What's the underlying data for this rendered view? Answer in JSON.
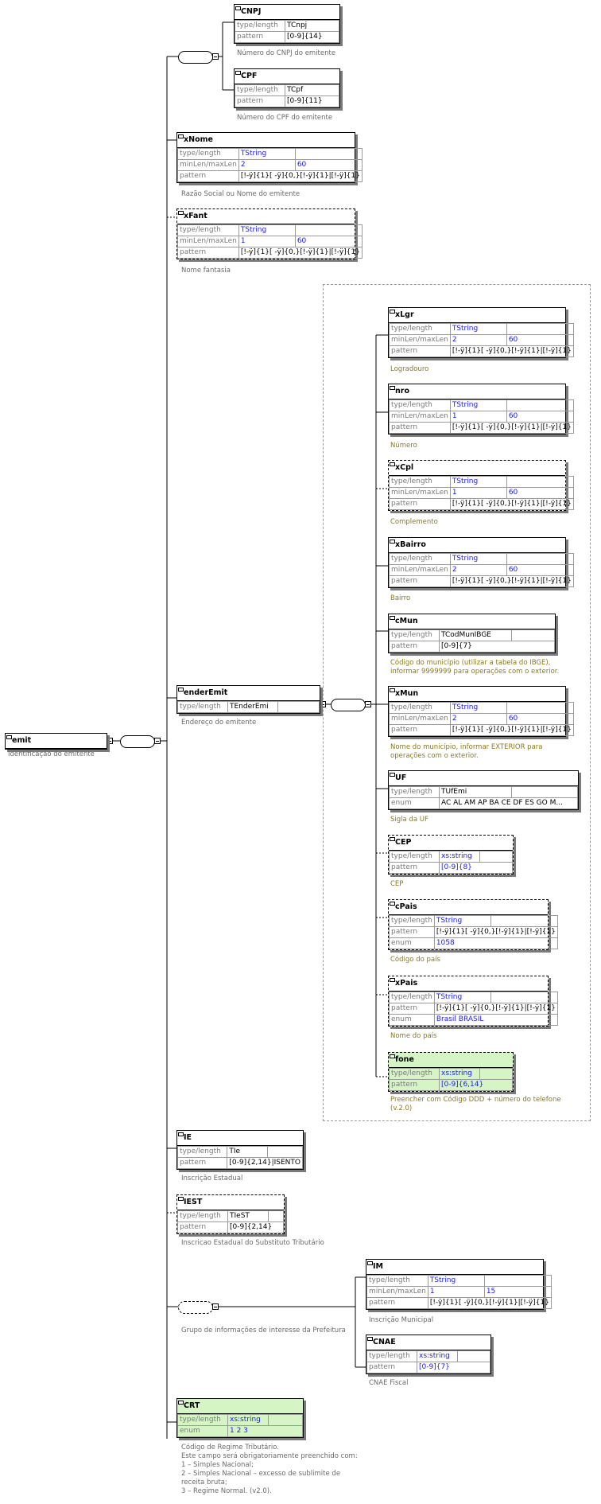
{
  "root": {
    "name": "emit",
    "desc": "Identificação do emitente"
  },
  "choice": [
    {
      "name": "CNPJ",
      "type": "TCnpj",
      "pattern": "[0-9]{14}",
      "desc": "Número do CNPJ do emitente"
    },
    {
      "name": "CPF",
      "type": "TCpf",
      "pattern": "[0-9]{11}",
      "desc": "Número do CPF do emitente"
    }
  ],
  "xNome": {
    "name": "xNome",
    "type": "TString",
    "min": "2",
    "max": "60",
    "pattern": "[!-ÿ]{1}[ -ÿ]{0,}[!-ÿ]{1}|[!-ÿ]{1}",
    "desc": "Razão Social ou Nome do emitente"
  },
  "xFant": {
    "name": "xFant",
    "type": "TString",
    "min": "1",
    "max": "60",
    "pattern": "[!-ÿ]{1}[ -ÿ]{0,}[!-ÿ]{1}|[!-ÿ]{1}",
    "desc": "Nome fantasia"
  },
  "enderEmit": {
    "name": "enderEmit",
    "type": "TEnderEmi",
    "desc": "Endereço do emitente"
  },
  "address": {
    "xLgr": {
      "name": "xLgr",
      "type": "TString",
      "min": "2",
      "max": "60",
      "pattern": "[!-ÿ]{1}[ -ÿ]{0,}[!-ÿ]{1}|[!-ÿ]{1}",
      "desc": "Logradouro"
    },
    "nro": {
      "name": "nro",
      "type": "TString",
      "min": "1",
      "max": "60",
      "pattern": "[!-ÿ]{1}[ -ÿ]{0,}[!-ÿ]{1}|[!-ÿ]{1}",
      "desc": "Número"
    },
    "xCpl": {
      "name": "xCpl",
      "type": "TString",
      "min": "1",
      "max": "60",
      "pattern": "[!-ÿ]{1}[ -ÿ]{0,}[!-ÿ]{1}|[!-ÿ]{1}",
      "desc": "Complemento"
    },
    "xBairro": {
      "name": "xBairro",
      "type": "TString",
      "min": "2",
      "max": "60",
      "pattern": "[!-ÿ]{1}[ -ÿ]{0,}[!-ÿ]{1}|[!-ÿ]{1}",
      "desc": "Bairro"
    },
    "cMun": {
      "name": "cMun",
      "type": "TCodMunIBGE",
      "pattern": "[0-9]{7}",
      "desc1": "Código do município (utilizar a tabela do IBGE),",
      "desc2": "informar 9999999 para operações com o exterior."
    },
    "xMun": {
      "name": "xMun",
      "type": "TString",
      "min": "2",
      "max": "60",
      "pattern": "[!-ÿ]{1}[ -ÿ]{0,}[!-ÿ]{1}|[!-ÿ]{1}",
      "desc1": "Nome do município, informar EXTERIOR para",
      "desc2": "operações com o exterior."
    },
    "UF": {
      "name": "UF",
      "type": "TUfEmi",
      "enum": "AC AL AM AP BA CE DF ES GO M...",
      "desc": "Sigla da UF"
    },
    "CEP": {
      "name": "CEP",
      "type": "xs:string",
      "pattern": "[0-9]{8}",
      "desc": "CEP"
    },
    "cPais": {
      "name": "cPais",
      "type": "TString",
      "pattern": "[!-ÿ]{1}[ -ÿ]{0,}[!-ÿ]{1}|[!-ÿ]{1}",
      "enum": "1058",
      "desc": "Código do país"
    },
    "xPais": {
      "name": "xPais",
      "type": "TString",
      "pattern": "[!-ÿ]{1}[ -ÿ]{0,}[!-ÿ]{1}|[!-ÿ]{1}",
      "enum": "Brasil BRASIL",
      "desc": "Nome do país"
    },
    "fone": {
      "name": "fone",
      "type": "xs:string",
      "pattern": "[0-9]{6,14}",
      "desc1": "Preencher com Código DDD + número do telefone",
      "desc2": "(v.2.0)"
    }
  },
  "IE": {
    "name": "IE",
    "type": "TIe",
    "pattern": "[0-9]{2,14}|ISENTO",
    "desc": "Inscrição Estadual"
  },
  "IEST": {
    "name": "IEST",
    "type": "TIeST",
    "pattern": "[0-9]{2,14}",
    "desc": "Inscricao Estadual do Substituto Tributário"
  },
  "prefGroup": {
    "desc": "Grupo de informações de interesse da Prefeitura"
  },
  "IM": {
    "name": "IM",
    "type": "TString",
    "min": "1",
    "max": "15",
    "pattern": "[!-ÿ]{1}[ -ÿ]{0,}[!-ÿ]{1}|[!-ÿ]{1}",
    "desc": "Inscrição Municipal"
  },
  "CNAE": {
    "name": "CNAE",
    "type": "xs:string",
    "pattern": "[0-9]{7}",
    "desc": "CNAE Fiscal"
  },
  "CRT": {
    "name": "CRT",
    "type": "xs:string",
    "enum": "1 2 3",
    "desc1": "Código de Regime Tributário.",
    "desc2": "Este campo será obrigatoriamente preenchido com:",
    "desc3": "1 – Simples Nacional;",
    "desc4": "2 – Simples Nacional – excesso de sublimite de",
    "desc5": "receita bruta;",
    "desc6": "3 – Regime Normal. (v2.0)."
  },
  "labels": {
    "type": "type/length",
    "minmax": "minLen/maxLen",
    "pattern": "pattern",
    "enum": "enum"
  }
}
